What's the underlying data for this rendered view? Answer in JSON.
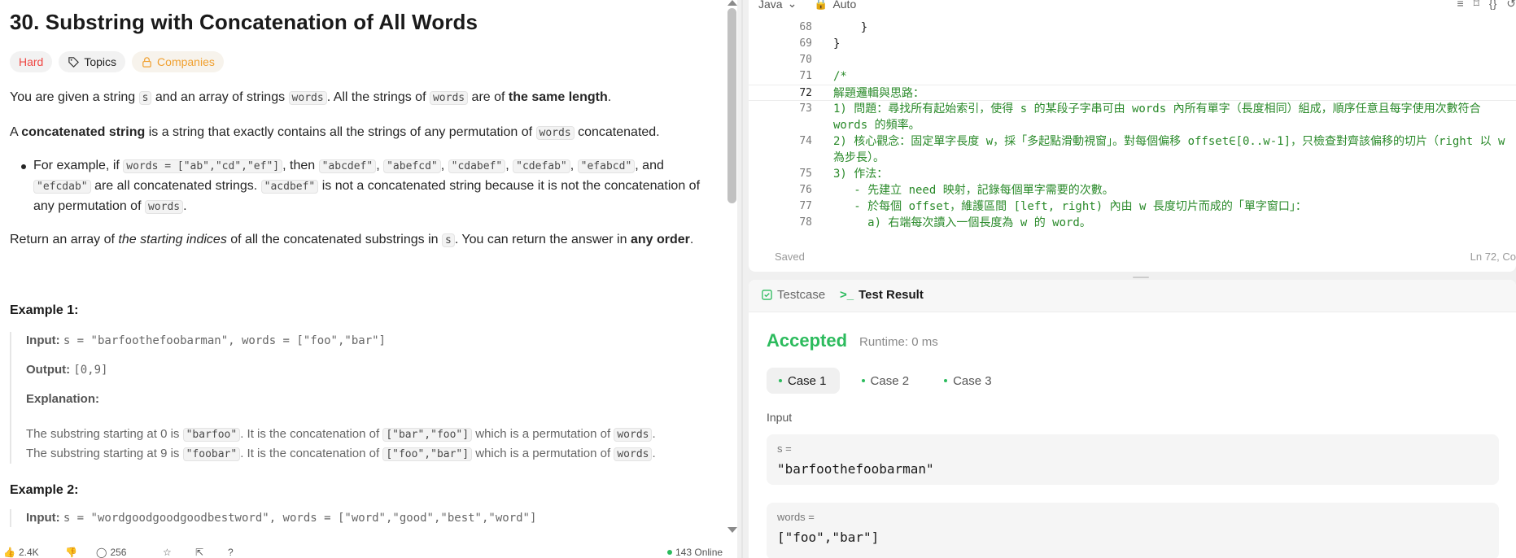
{
  "problem": {
    "title": "30. Substring with Concatenation of All Words",
    "tags": {
      "difficulty": "Hard",
      "topics": "Topics",
      "companies": "Companies"
    },
    "p1": {
      "t1": "You are given a string ",
      "c1": "s",
      "t2": " and an array of strings ",
      "c2": "words",
      "t3": ". All the strings of ",
      "c3": "words",
      "t4": " are of ",
      "b1": "the same length",
      "t5": "."
    },
    "p2": {
      "t1": "A ",
      "b1": "concatenated string",
      "t2": " is a string that exactly contains all the strings of any permutation of ",
      "c1": "words",
      "t3": " concatenated."
    },
    "bullet": {
      "t1": "For example, if ",
      "c1": "words = [\"ab\",\"cd\",\"ef\"]",
      "t2": ", then ",
      "c2": "\"abcdef\"",
      "c3": "\"abefcd\"",
      "c4": "\"cdabef\"",
      "c5": "\"cdefab\"",
      "c6": "\"efabcd\"",
      "t3": ", and ",
      "c7": "\"efcdab\"",
      "t4": " are all concatenated strings. ",
      "c8": "\"acdbef\"",
      "t5": " is not a concatenated string because it is not the concatenation of any permutation of ",
      "c9": "words",
      "t6": "."
    },
    "p3": {
      "t1": "Return an array of ",
      "i1": "the starting indices",
      "t2": " of all the concatenated substrings in ",
      "c1": "s",
      "t3": ". You can return the answer in ",
      "b1": "any order",
      "t4": "."
    },
    "example1": {
      "title": "Example 1:",
      "input_label": "Input:",
      "input_value": "s = \"barfoothefoobarman\", words = [\"foo\",\"bar\"]",
      "output_label": "Output:",
      "output_value": "[0,9]",
      "explanation_label": "Explanation:",
      "line1": {
        "t1": "The substring starting at 0 is ",
        "c1": "\"barfoo\"",
        "t2": ". It is the concatenation of ",
        "c2": "[\"bar\",\"foo\"]",
        "t3": " which is a permutation of ",
        "c3": "words",
        "t4": "."
      },
      "line2": {
        "t1": "The substring starting at 9 is ",
        "c1": "\"foobar\"",
        "t2": ". It is the concatenation of ",
        "c2": "[\"foo\",\"bar\"]",
        "t3": " which is a permutation of ",
        "c3": "words",
        "t4": "."
      }
    },
    "example2": {
      "title": "Example 2:",
      "input_label": "Input:",
      "input_value": "s = \"wordgoodgoodgoodbestword\", words = [\"word\",\"good\",\"best\",\"word\"]"
    },
    "bottom": {
      "likes": "2.4K",
      "comments": "256",
      "online": "143 Online"
    }
  },
  "editor": {
    "language": "Java",
    "mode": "Auto",
    "status": "Saved",
    "cursor": "Ln 72, Co",
    "lines": [
      {
        "n": "",
        "text": "    }}...[...]..."
      },
      {
        "n": "68",
        "text": "    }"
      },
      {
        "n": "69",
        "text": "}"
      },
      {
        "n": "70",
        "text": ""
      },
      {
        "n": "71",
        "text": "/*"
      },
      {
        "n": "72",
        "text": "解題邏輯與思路："
      },
      {
        "n": "73",
        "text": "1) 問題：尋找所有起始索引，使得 s 的某段子字串可由 words 內所有單字（長度相同）組成，順序任意且每字使用次數符合 words 的頻率。"
      },
      {
        "n": "74",
        "text": "2) 核心觀念：固定單字長度 w，採「多起點滑動視窗」。對每個偏移 offset∈[0..w-1]，只檢查對齊該偏移的切片（right 以 w 為步長）。"
      },
      {
        "n": "75",
        "text": "3) 作法："
      },
      {
        "n": "76",
        "text": "   - 先建立 need 映射，記錄每個單字需要的次數。"
      },
      {
        "n": "77",
        "text": "   - 於每個 offset，維護區間 [left, right) 內由 w 長度切片而成的「單字窗口」："
      },
      {
        "n": "78",
        "text": "     a) 右端每次讀入一個長度為 w 的 word。"
      }
    ]
  },
  "result": {
    "tab_testcase": "Testcase",
    "tab_result": "Test Result",
    "verdict": "Accepted",
    "runtime": "Runtime: 0 ms",
    "cases": [
      "Case 1",
      "Case 2",
      "Case 3"
    ],
    "input_label": "Input",
    "s_name": "s =",
    "s_value": "\"barfoothefoobarman\"",
    "words_name": "words =",
    "words_value": "[\"foo\",\"bar\"]"
  },
  "colors": {
    "accepted": "#2cbb5d",
    "hard": "#ef4743",
    "companies": "#f0a030",
    "comment": "#2a8a2a"
  }
}
